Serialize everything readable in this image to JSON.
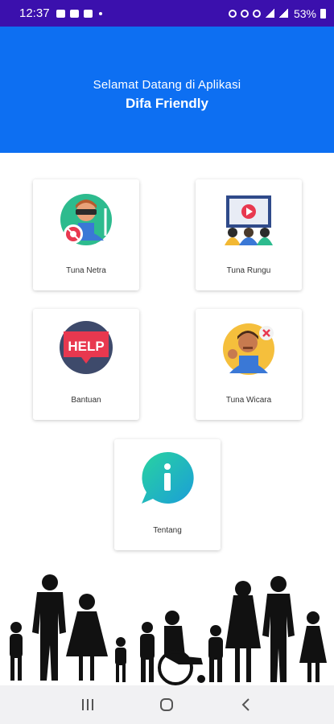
{
  "status_bar": {
    "time": "12:37",
    "battery": "53%"
  },
  "header": {
    "welcome": "Selamat Datang di Aplikasi",
    "app_name": "Difa Friendly",
    "color": "#0d6ff2"
  },
  "menu": [
    {
      "label": "Tuna Netra",
      "icon": "blind-person-icon"
    },
    {
      "label": "Tuna Rungu",
      "icon": "deaf-audience-icon"
    },
    {
      "label": "Bantuan",
      "icon": "help-bubble-icon",
      "icon_text": "HELP"
    },
    {
      "label": "Tuna Wicara",
      "icon": "mute-person-icon"
    },
    {
      "label": "Tentang",
      "icon": "info-bubble-icon"
    }
  ],
  "nav_bar": {
    "recent": "recents-icon",
    "home": "home-icon",
    "back": "back-icon"
  }
}
